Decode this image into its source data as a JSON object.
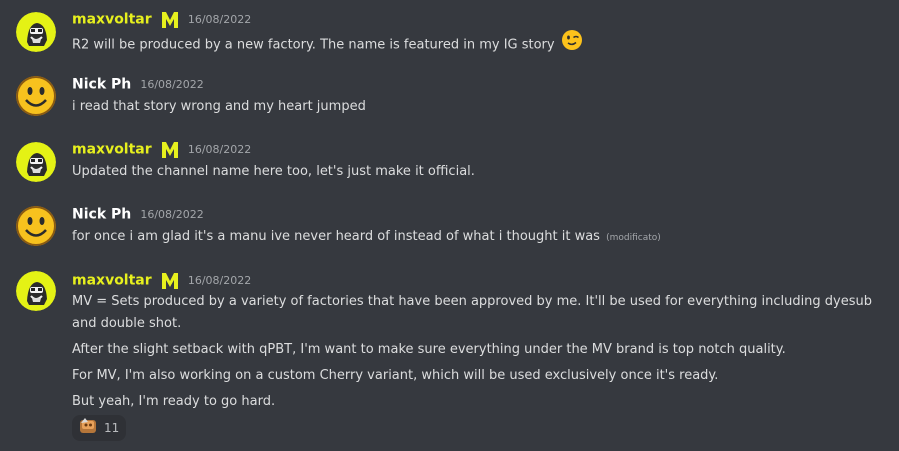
{
  "colors": {
    "background": "#36393f",
    "maxvoltar_name": "#e7f01e",
    "default_name": "#ffffff",
    "message_text": "#dcddde",
    "timestamp": "#a3a6aa"
  },
  "messages": [
    {
      "author": "maxvoltar",
      "timestamp": "16/08/2022",
      "badge": "mv-logo-icon",
      "avatar": "maxvoltar-avatar",
      "lines": [
        "R2 will be produced by a new factory. The name is featured in my IG story"
      ],
      "emoji": "winking-face-emoji"
    },
    {
      "author": "Nick Ph",
      "timestamp": "16/08/2022",
      "avatar": "smiley-avatar",
      "lines": [
        "i read that story wrong and my heart jumped"
      ]
    },
    {
      "author": "maxvoltar",
      "timestamp": "16/08/2022",
      "badge": "mv-logo-icon",
      "avatar": "maxvoltar-avatar",
      "lines": [
        "Updated the channel name here too, let's just make it official."
      ]
    },
    {
      "author": "Nick Ph",
      "timestamp": "16/08/2022",
      "avatar": "smiley-avatar",
      "lines": [
        "for once i am glad it's a manu ive never heard of instead of what i thought it was"
      ],
      "edited_label": "(modificato)"
    },
    {
      "author": "maxvoltar",
      "timestamp": "16/08/2022",
      "badge": "mv-logo-icon",
      "avatar": "maxvoltar-avatar",
      "lines": [
        "MV = Sets produced by a variety of factories that have been approved by me. It'll be used for everything including dyesub",
        "and double shot.",
        "After the slight setback with qPBT, I'm want to make sure everything under the MV brand is top notch quality.",
        "For MV, I'm also working on a custom Cherry variant, which will be used exclusively once it's ready.",
        "But yeah, I'm ready to go hard."
      ],
      "reaction": {
        "emoji": "custom-keycap-emoji",
        "count": "11"
      }
    }
  ]
}
